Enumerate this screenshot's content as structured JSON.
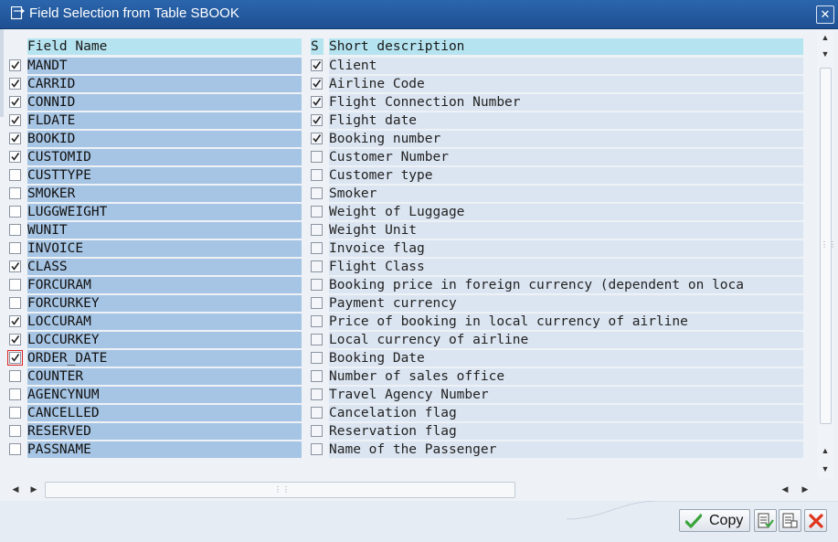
{
  "window": {
    "title": "Field Selection from Table SBOOK",
    "close": "✕"
  },
  "columns": {
    "field": "Field Name",
    "sel": "S",
    "desc": "Short description"
  },
  "rows": [
    {
      "field": "MANDT",
      "desc": "Client",
      "chk": true,
      "sel": true
    },
    {
      "field": "CARRID",
      "desc": "Airline Code",
      "chk": true,
      "sel": true
    },
    {
      "field": "CONNID",
      "desc": "Flight Connection Number",
      "chk": true,
      "sel": true
    },
    {
      "field": "FLDATE",
      "desc": "Flight date",
      "chk": true,
      "sel": true
    },
    {
      "field": "BOOKID",
      "desc": "Booking number",
      "chk": true,
      "sel": true
    },
    {
      "field": "CUSTOMID",
      "desc": "Customer Number",
      "chk": true,
      "sel": false
    },
    {
      "field": "CUSTTYPE",
      "desc": "Customer type",
      "chk": false,
      "sel": false
    },
    {
      "field": "SMOKER",
      "desc": "Smoker",
      "chk": false,
      "sel": false
    },
    {
      "field": "LUGGWEIGHT",
      "desc": "Weight of Luggage",
      "chk": false,
      "sel": false
    },
    {
      "field": "WUNIT",
      "desc": "Weight Unit",
      "chk": false,
      "sel": false
    },
    {
      "field": "INVOICE",
      "desc": "Invoice flag",
      "chk": false,
      "sel": false
    },
    {
      "field": "CLASS",
      "desc": "Flight Class",
      "chk": true,
      "sel": false
    },
    {
      "field": "FORCURAM",
      "desc": "Booking price in foreign currency (dependent on loca",
      "chk": false,
      "sel": false
    },
    {
      "field": "FORCURKEY",
      "desc": "Payment currency",
      "chk": false,
      "sel": false
    },
    {
      "field": "LOCCURAM",
      "desc": "Price of booking in local currency of airline",
      "chk": true,
      "sel": false
    },
    {
      "field": "LOCCURKEY",
      "desc": "Local currency of airline",
      "chk": true,
      "sel": false
    },
    {
      "field": "ORDER_DATE",
      "desc": "Booking Date",
      "chk": true,
      "sel": false,
      "focus": true
    },
    {
      "field": "COUNTER",
      "desc": "Number of sales office",
      "chk": false,
      "sel": false
    },
    {
      "field": "AGENCYNUM",
      "desc": "Travel Agency Number",
      "chk": false,
      "sel": false
    },
    {
      "field": "CANCELLED",
      "desc": "Cancelation flag",
      "chk": false,
      "sel": false
    },
    {
      "field": "RESERVED",
      "desc": "Reservation flag",
      "chk": false,
      "sel": false
    },
    {
      "field": "PASSNAME",
      "desc": "Name of the Passenger",
      "chk": false,
      "sel": false
    }
  ],
  "footer": {
    "copy_label": "Copy"
  },
  "colors": {
    "title_bar": "#2b66ad",
    "header_bg": "#b5e4f0",
    "field_bg": "#a6c4e3",
    "desc_bg": "#dbe5f1",
    "check_green": "#3aa33a",
    "cancel_red": "#e0341c"
  },
  "icons": {
    "window": "dialog-icon",
    "close": "close-icon",
    "copy": "checkmark-icon",
    "select_all": "select-all-icon",
    "deselect_all": "deselect-all-icon",
    "cancel": "cancel-icon"
  }
}
